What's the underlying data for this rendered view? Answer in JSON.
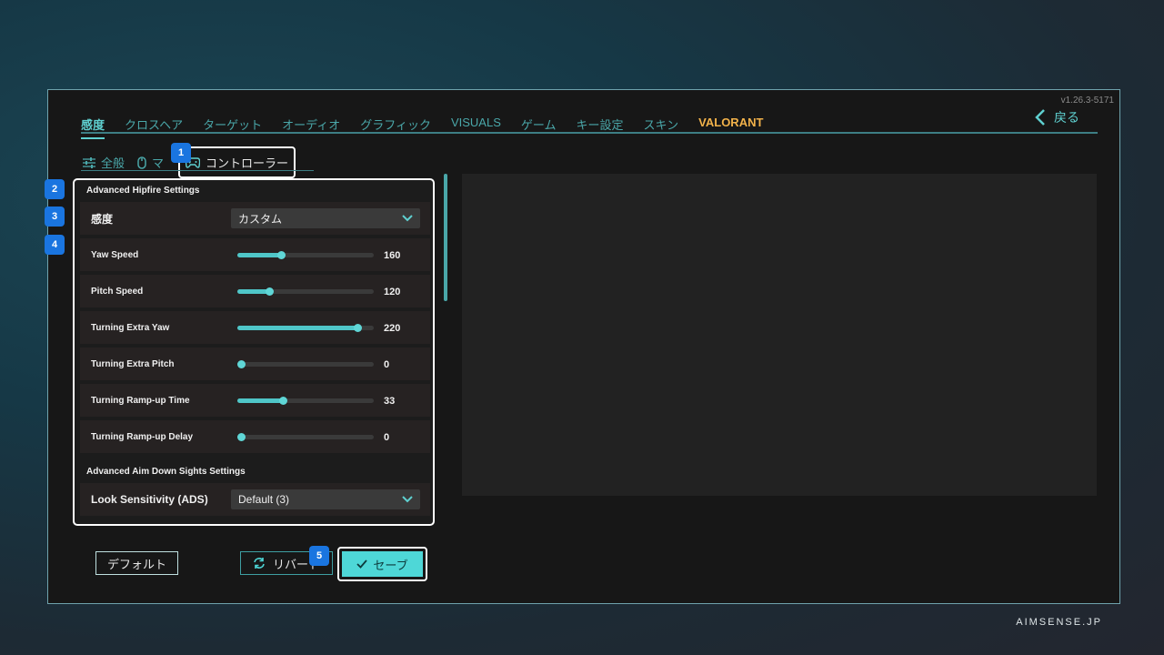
{
  "version": "v1.26.3-5171",
  "tabs": [
    {
      "label": "感度",
      "active": true
    },
    {
      "label": "クロスヘア"
    },
    {
      "label": "ターゲット"
    },
    {
      "label": "オーディオ"
    },
    {
      "label": "グラフィック"
    },
    {
      "label": "VISUALS"
    },
    {
      "label": "ゲーム"
    },
    {
      "label": "キー設定"
    },
    {
      "label": "スキン"
    },
    {
      "label": "VALORANT",
      "brand": true
    }
  ],
  "back_label": "戻る",
  "subtabs": [
    {
      "label": "全般",
      "icon": "sliders-icon"
    },
    {
      "label": "マ",
      "icon": "mouse-icon"
    },
    {
      "label": "コントローラー",
      "icon": "gamepad-icon",
      "active": true
    }
  ],
  "badges": [
    "1",
    "2",
    "3",
    "4",
    "5"
  ],
  "hipfire": {
    "title": "Advanced Hipfire Settings",
    "sensitivity": {
      "label": "感度",
      "value": "カスタム"
    },
    "sliders": [
      {
        "label": "Yaw Speed",
        "value": "160",
        "fill": 0.32
      },
      {
        "label": "Pitch Speed",
        "value": "120",
        "fill": 0.23
      },
      {
        "label": "Turning Extra Yaw",
        "value": "220",
        "fill": 0.88
      },
      {
        "label": "Turning Extra Pitch",
        "value": "0",
        "fill": 0.0
      },
      {
        "label": "Turning Ramp-up Time",
        "value": "33",
        "fill": 0.33
      },
      {
        "label": "Turning Ramp-up Delay",
        "value": "0",
        "fill": 0.0
      }
    ]
  },
  "ads": {
    "title": "Advanced Aim Down Sights Settings",
    "look": {
      "label": "Look Sensitivity (ADS)",
      "value": "Default (3)"
    }
  },
  "buttons": {
    "default": "デフォルト",
    "revert": "リバート",
    "save": "セーブ"
  },
  "footer_brand": "AIMSENSE.JP",
  "colors": {
    "accent": "#4ed7d7",
    "tab_text": "#4aa7a9",
    "brand": "#f2b24a",
    "badge": "#1a75e0"
  }
}
